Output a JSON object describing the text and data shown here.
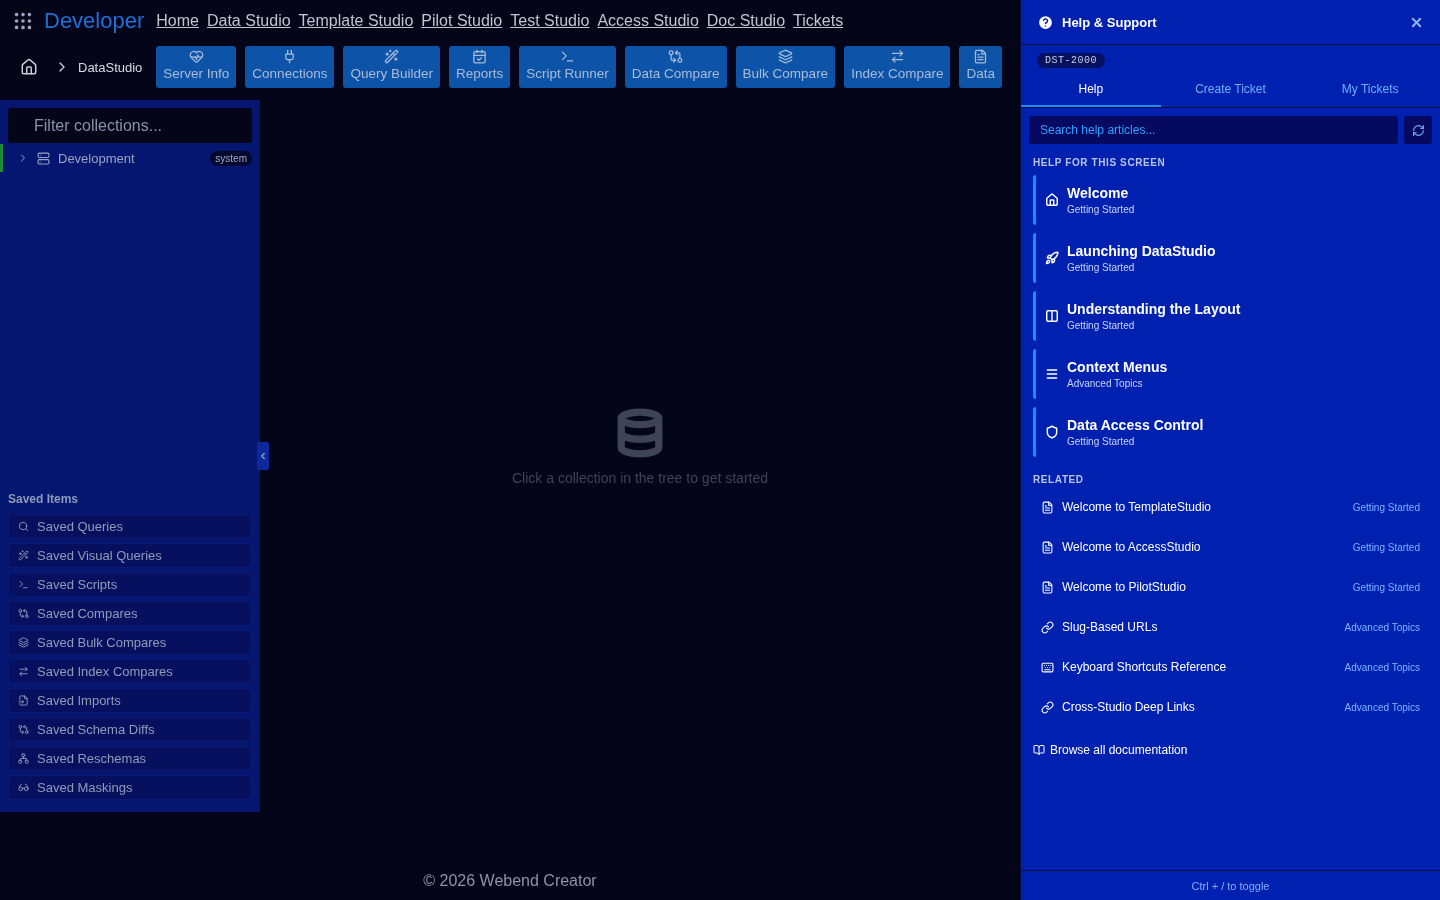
{
  "app": {
    "title": "Developer"
  },
  "nav_links": [
    "Home",
    "Data Studio",
    "Template Studio",
    "Pilot Studio",
    "Test Studio",
    "Access Studio",
    "Doc Studio",
    "Tickets"
  ],
  "breadcrumb": {
    "current": "DataStudio"
  },
  "toolbar": [
    "Server Info",
    "Connections",
    "Query Builder",
    "Reports",
    "Script Runner",
    "Data Compare",
    "Bulk Compare",
    "Index Compare",
    "Data"
  ],
  "sidebar": {
    "filter_placeholder": "Filter collections...",
    "tree": [
      {
        "label": "Development",
        "badge": "system",
        "expanded": false
      }
    ],
    "saved_title": "Saved Items",
    "saved_items": [
      "Saved Queries",
      "Saved Visual Queries",
      "Saved Scripts",
      "Saved Compares",
      "Saved Bulk Compares",
      "Saved Index Compares",
      "Saved Imports",
      "Saved Schema Diffs",
      "Saved Reschemas",
      "Saved Maskings"
    ]
  },
  "empty_state": {
    "message": "Click a collection in the tree to get started"
  },
  "footer": "© 2026 Webend Creator",
  "help_panel": {
    "title": "Help & Support",
    "code": "DST-2000",
    "tabs": [
      {
        "label": "Help",
        "selected": true
      },
      {
        "label": "Create Ticket",
        "selected": false
      },
      {
        "label": "My Tickets",
        "selected": false
      }
    ],
    "search_placeholder": "Search help articles...",
    "section_title": "HELP FOR THIS SCREEN",
    "articles": [
      {
        "title": "Welcome",
        "category": "Getting Started"
      },
      {
        "title": "Launching DataStudio",
        "category": "Getting Started"
      },
      {
        "title": "Understanding the Layout",
        "category": "Getting Started"
      },
      {
        "title": "Context Menus",
        "category": "Advanced Topics"
      },
      {
        "title": "Data Access Control",
        "category": "Getting Started"
      }
    ],
    "related_title": "RELATED",
    "related": [
      {
        "title": "Welcome to TemplateStudio",
        "category": "Getting Started"
      },
      {
        "title": "Welcome to AccessStudio",
        "category": "Getting Started"
      },
      {
        "title": "Welcome to PilotStudio",
        "category": "Getting Started"
      },
      {
        "title": "Slug-Based URLs",
        "category": "Advanced Topics"
      },
      {
        "title": "Keyboard Shortcuts Reference",
        "category": "Advanced Topics"
      },
      {
        "title": "Cross-Studio Deep Links",
        "category": "Advanced Topics"
      }
    ],
    "browse_link": "Browse all documentation",
    "hint": "Ctrl + / to toggle"
  }
}
